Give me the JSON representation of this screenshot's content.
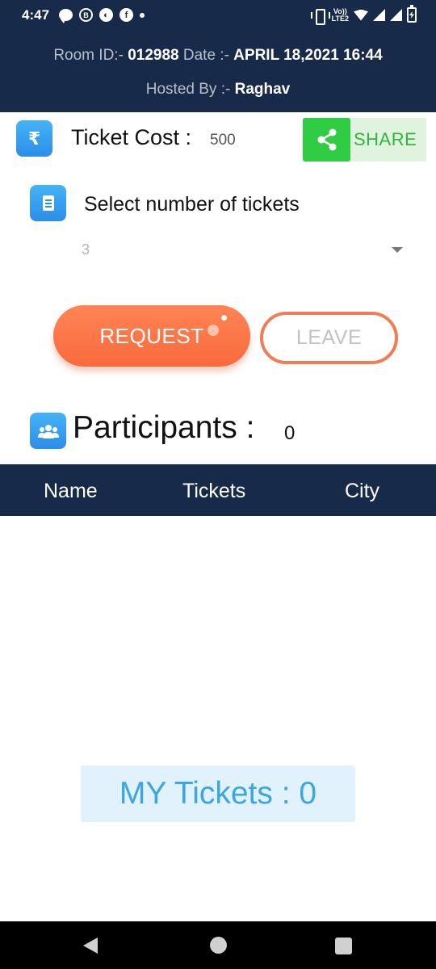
{
  "status_bar": {
    "time": "4:47",
    "lte_top": "Vo))",
    "lte_bottom": "LTE2",
    "icons": [
      "chat-bubble-icon",
      "b-circle-icon",
      "app-circle-icon",
      "facebook-icon",
      "dot-icon",
      "vibrate-icon",
      "volte-icon",
      "wifi-icon",
      "signal-icon",
      "signal-icon",
      "battery-charging-icon"
    ]
  },
  "header": {
    "room_label": "Room ID:- ",
    "room_id": "012988",
    "date_label": " Date :- ",
    "date_value": "APRIL 18,2021 16:44",
    "hosted_label": "Hosted By :- ",
    "host_name": "Raghav",
    "background_color": "#172a4a"
  },
  "ticket_cost": {
    "icon": "rupee-icon",
    "rupee_glyph": "₹",
    "label": "Ticket Cost :",
    "value": "500"
  },
  "share": {
    "label": "SHARE",
    "icon": "share-icon",
    "color": "#2fcc44"
  },
  "tickets_select": {
    "icon": "receipt-icon",
    "label": "Select number of tickets",
    "selected": "3"
  },
  "actions": {
    "request_label": "REQUEST",
    "leave_label": "LEAVE",
    "accent_color": "#f96a3c"
  },
  "participants": {
    "icon": "people-icon",
    "label": "Participants :",
    "count": "0",
    "columns": [
      "Name",
      "Tickets",
      "City"
    ],
    "rows": []
  },
  "my_tickets": {
    "label": "MY Tickets : 0"
  },
  "nav_bar": {
    "items": [
      "back-icon",
      "home-icon",
      "recents-icon"
    ]
  }
}
